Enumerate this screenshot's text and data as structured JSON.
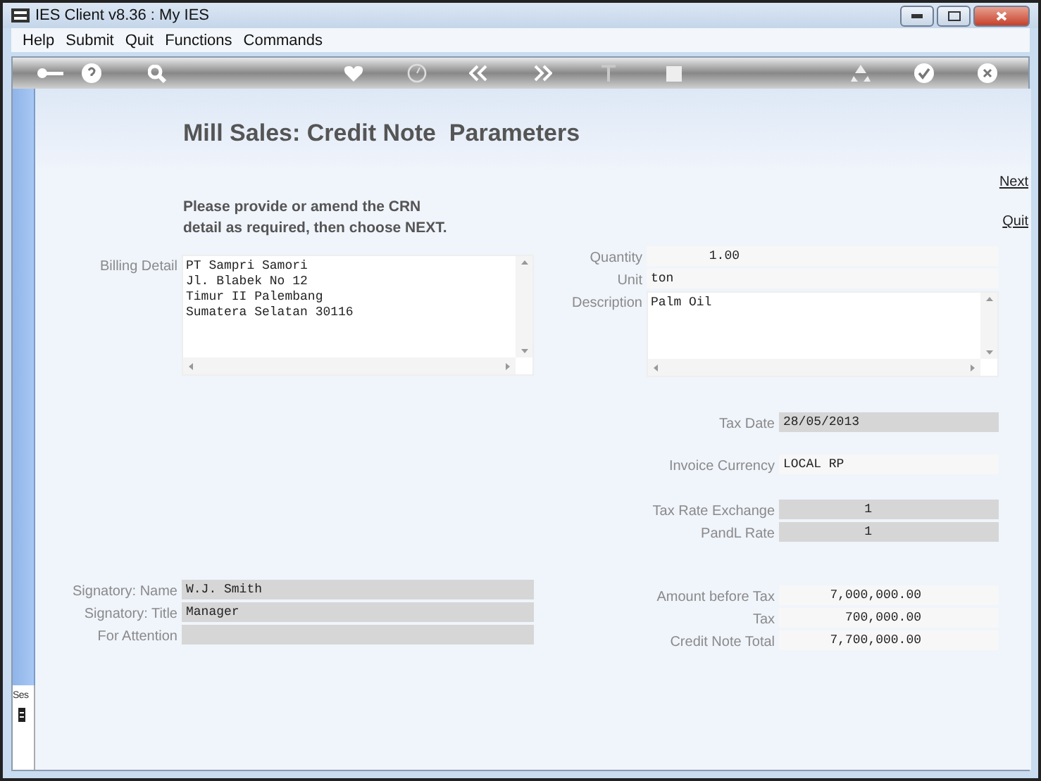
{
  "window": {
    "title": "IES Client v8.36 : My IES"
  },
  "menu": [
    {
      "label": "Help"
    },
    {
      "label": "Submit"
    },
    {
      "label": "Quit"
    },
    {
      "label": "Functions"
    },
    {
      "label": "Commands"
    }
  ],
  "page": {
    "title": "Mill Sales: Credit Note  Parameters",
    "instructions": "Please provide or amend the CRN\ndetail as required, then choose NEXT."
  },
  "actions": [
    {
      "label": "Next"
    },
    {
      "label": "Quit"
    }
  ],
  "left_groups": [
    {
      "fields": [
        {
          "label": "Billing Detail",
          "kind": "textarea",
          "value": "PT Sampri Samori\nJl. Blabek No 12\nTimur II Palembang\nSumatera Selatan 30116",
          "disabled": false
        }
      ]
    },
    {
      "fields": [
        {
          "label": "Signatory: Name",
          "kind": "text",
          "value": "W.J. Smith",
          "disabled": true
        },
        {
          "label": "Signatory: Title",
          "kind": "text",
          "value": "Manager",
          "disabled": true
        },
        {
          "label": "For Attention",
          "kind": "text",
          "disabled": true
        }
      ]
    }
  ],
  "right_groups": [
    {
      "fields": [
        {
          "label": "Quantity",
          "kind": "number",
          "value": "1.00",
          "disabled": false
        },
        {
          "label": "Unit",
          "kind": "text",
          "value": "ton",
          "disabled": false
        },
        {
          "label": "Description",
          "kind": "textarea",
          "value": "Palm Oil",
          "disabled": false
        }
      ]
    },
    {
      "fields": [
        {
          "label": "Tax Date",
          "kind": "text",
          "value": "28/05/2013",
          "disabled": true
        }
      ]
    },
    {
      "fields": [
        {
          "label": "Invoice Currency",
          "kind": "text",
          "value": "LOCAL RP",
          "disabled": false
        }
      ]
    },
    {
      "fields": [
        {
          "label": "Tax Rate Exchange",
          "kind": "number",
          "value": "1",
          "disabled": true
        },
        {
          "label": "PandL Rate",
          "kind": "number",
          "value": "1",
          "disabled": true
        }
      ]
    },
    {
      "fields": [
        {
          "label": "Amount before Tax",
          "kind": "number",
          "value": "7,000,000.00",
          "disabled": false
        },
        {
          "label": "Tax",
          "kind": "number",
          "value": "700,000.00",
          "disabled": false
        },
        {
          "label": "Credit Note Total",
          "kind": "number",
          "value": "7,700,000.00",
          "disabled": false
        }
      ]
    }
  ],
  "side_panel": {
    "label": "Ses"
  }
}
